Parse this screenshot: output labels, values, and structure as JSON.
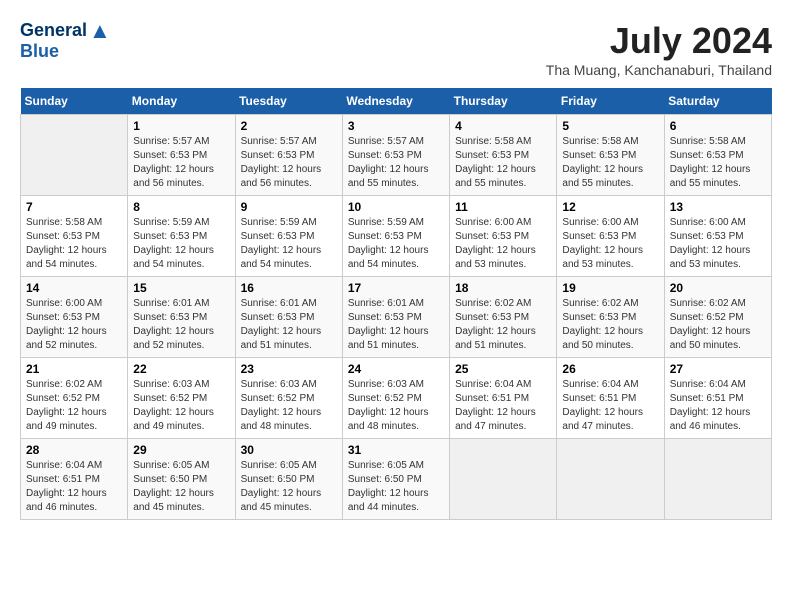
{
  "header": {
    "logo_line1": "General",
    "logo_line2": "Blue",
    "title": "July 2024",
    "subtitle": "Tha Muang, Kanchanaburi, Thailand"
  },
  "calendar": {
    "days_of_week": [
      "Sunday",
      "Monday",
      "Tuesday",
      "Wednesday",
      "Thursday",
      "Friday",
      "Saturday"
    ],
    "weeks": [
      [
        {
          "date": "",
          "info": ""
        },
        {
          "date": "1",
          "info": "Sunrise: 5:57 AM\nSunset: 6:53 PM\nDaylight: 12 hours\nand 56 minutes."
        },
        {
          "date": "2",
          "info": "Sunrise: 5:57 AM\nSunset: 6:53 PM\nDaylight: 12 hours\nand 56 minutes."
        },
        {
          "date": "3",
          "info": "Sunrise: 5:57 AM\nSunset: 6:53 PM\nDaylight: 12 hours\nand 55 minutes."
        },
        {
          "date": "4",
          "info": "Sunrise: 5:58 AM\nSunset: 6:53 PM\nDaylight: 12 hours\nand 55 minutes."
        },
        {
          "date": "5",
          "info": "Sunrise: 5:58 AM\nSunset: 6:53 PM\nDaylight: 12 hours\nand 55 minutes."
        },
        {
          "date": "6",
          "info": "Sunrise: 5:58 AM\nSunset: 6:53 PM\nDaylight: 12 hours\nand 55 minutes."
        }
      ],
      [
        {
          "date": "7",
          "info": "Sunrise: 5:58 AM\nSunset: 6:53 PM\nDaylight: 12 hours\nand 54 minutes."
        },
        {
          "date": "8",
          "info": "Sunrise: 5:59 AM\nSunset: 6:53 PM\nDaylight: 12 hours\nand 54 minutes."
        },
        {
          "date": "9",
          "info": "Sunrise: 5:59 AM\nSunset: 6:53 PM\nDaylight: 12 hours\nand 54 minutes."
        },
        {
          "date": "10",
          "info": "Sunrise: 5:59 AM\nSunset: 6:53 PM\nDaylight: 12 hours\nand 54 minutes."
        },
        {
          "date": "11",
          "info": "Sunrise: 6:00 AM\nSunset: 6:53 PM\nDaylight: 12 hours\nand 53 minutes."
        },
        {
          "date": "12",
          "info": "Sunrise: 6:00 AM\nSunset: 6:53 PM\nDaylight: 12 hours\nand 53 minutes."
        },
        {
          "date": "13",
          "info": "Sunrise: 6:00 AM\nSunset: 6:53 PM\nDaylight: 12 hours\nand 53 minutes."
        }
      ],
      [
        {
          "date": "14",
          "info": "Sunrise: 6:00 AM\nSunset: 6:53 PM\nDaylight: 12 hours\nand 52 minutes."
        },
        {
          "date": "15",
          "info": "Sunrise: 6:01 AM\nSunset: 6:53 PM\nDaylight: 12 hours\nand 52 minutes."
        },
        {
          "date": "16",
          "info": "Sunrise: 6:01 AM\nSunset: 6:53 PM\nDaylight: 12 hours\nand 51 minutes."
        },
        {
          "date": "17",
          "info": "Sunrise: 6:01 AM\nSunset: 6:53 PM\nDaylight: 12 hours\nand 51 minutes."
        },
        {
          "date": "18",
          "info": "Sunrise: 6:02 AM\nSunset: 6:53 PM\nDaylight: 12 hours\nand 51 minutes."
        },
        {
          "date": "19",
          "info": "Sunrise: 6:02 AM\nSunset: 6:53 PM\nDaylight: 12 hours\nand 50 minutes."
        },
        {
          "date": "20",
          "info": "Sunrise: 6:02 AM\nSunset: 6:52 PM\nDaylight: 12 hours\nand 50 minutes."
        }
      ],
      [
        {
          "date": "21",
          "info": "Sunrise: 6:02 AM\nSunset: 6:52 PM\nDaylight: 12 hours\nand 49 minutes."
        },
        {
          "date": "22",
          "info": "Sunrise: 6:03 AM\nSunset: 6:52 PM\nDaylight: 12 hours\nand 49 minutes."
        },
        {
          "date": "23",
          "info": "Sunrise: 6:03 AM\nSunset: 6:52 PM\nDaylight: 12 hours\nand 48 minutes."
        },
        {
          "date": "24",
          "info": "Sunrise: 6:03 AM\nSunset: 6:52 PM\nDaylight: 12 hours\nand 48 minutes."
        },
        {
          "date": "25",
          "info": "Sunrise: 6:04 AM\nSunset: 6:51 PM\nDaylight: 12 hours\nand 47 minutes."
        },
        {
          "date": "26",
          "info": "Sunrise: 6:04 AM\nSunset: 6:51 PM\nDaylight: 12 hours\nand 47 minutes."
        },
        {
          "date": "27",
          "info": "Sunrise: 6:04 AM\nSunset: 6:51 PM\nDaylight: 12 hours\nand 46 minutes."
        }
      ],
      [
        {
          "date": "28",
          "info": "Sunrise: 6:04 AM\nSunset: 6:51 PM\nDaylight: 12 hours\nand 46 minutes."
        },
        {
          "date": "29",
          "info": "Sunrise: 6:05 AM\nSunset: 6:50 PM\nDaylight: 12 hours\nand 45 minutes."
        },
        {
          "date": "30",
          "info": "Sunrise: 6:05 AM\nSunset: 6:50 PM\nDaylight: 12 hours\nand 45 minutes."
        },
        {
          "date": "31",
          "info": "Sunrise: 6:05 AM\nSunset: 6:50 PM\nDaylight: 12 hours\nand 44 minutes."
        },
        {
          "date": "",
          "info": ""
        },
        {
          "date": "",
          "info": ""
        },
        {
          "date": "",
          "info": ""
        }
      ]
    ]
  }
}
